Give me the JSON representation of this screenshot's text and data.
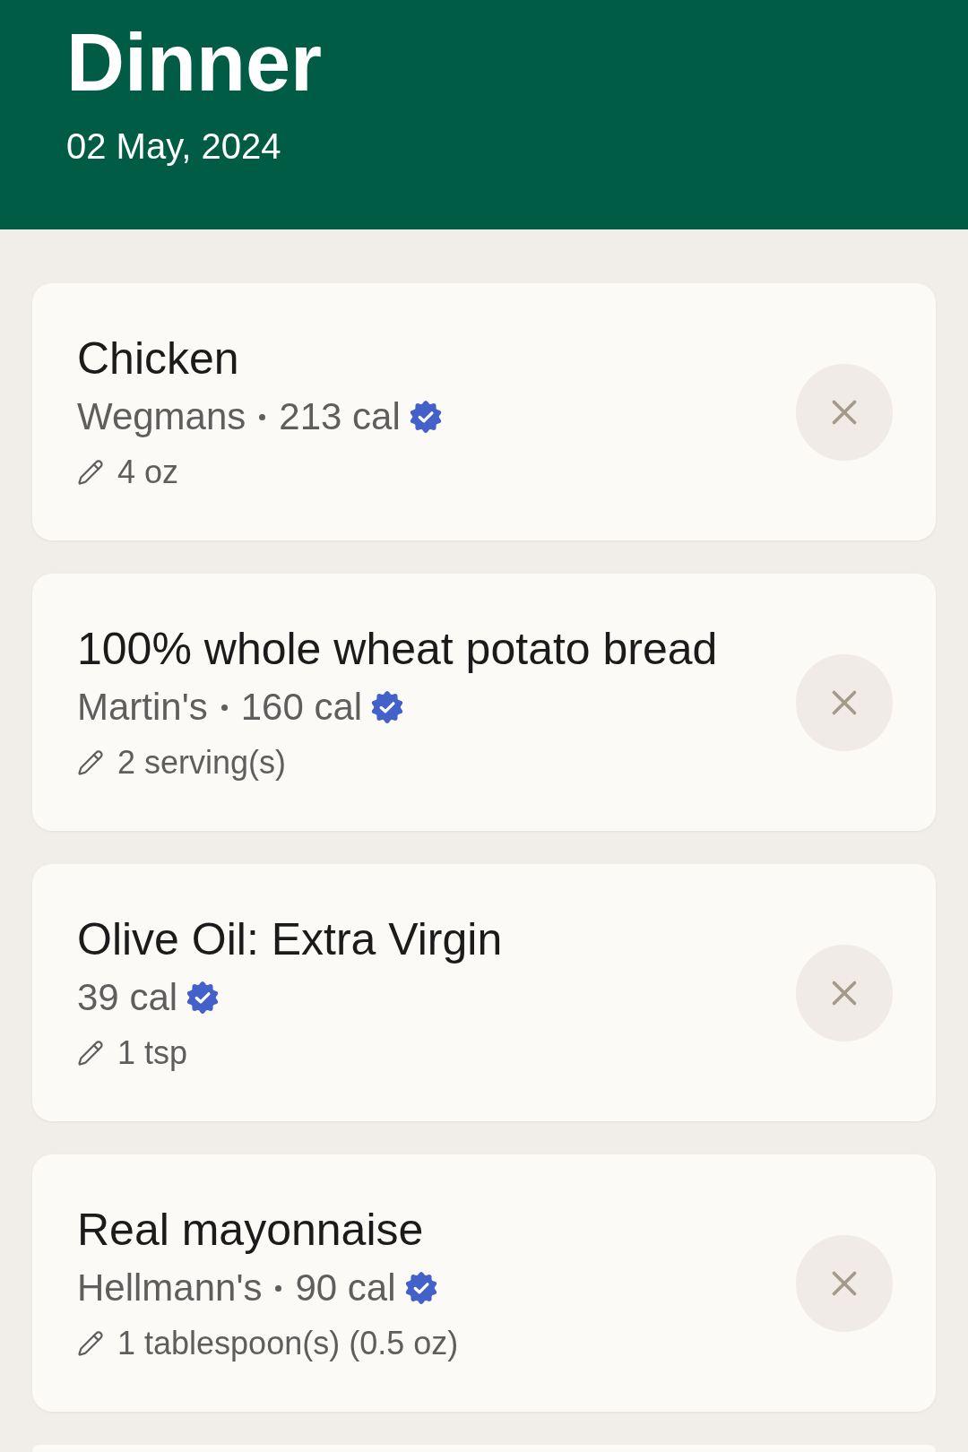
{
  "header": {
    "title": "Dinner",
    "date": "02 May, 2024"
  },
  "entries": [
    {
      "name": "Chicken",
      "brand": "Wegmans",
      "calories": "213 cal",
      "verified": true,
      "quantity": "4 oz"
    },
    {
      "name": "100% whole wheat potato bread",
      "brand": "Martin's",
      "calories": "160 cal",
      "verified": true,
      "quantity": "2 serving(s)"
    },
    {
      "name": "Olive Oil: Extra Virgin",
      "calories": "39 cal",
      "verified": true,
      "quantity": "1 tsp"
    },
    {
      "name": "Real mayonnaise",
      "brand": "Hellmann's",
      "calories": "90 cal",
      "verified": true,
      "quantity": "1 tablespoon(s) (0.5 oz)"
    }
  ]
}
